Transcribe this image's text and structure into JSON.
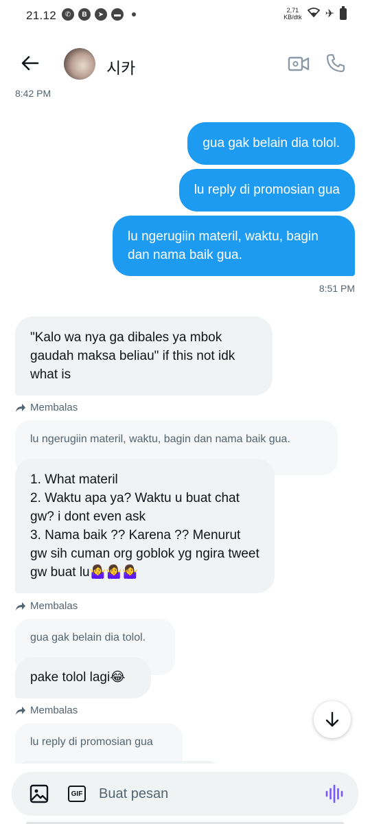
{
  "status_bar": {
    "time": "21.12",
    "speed_value": "2,71",
    "speed_unit": "KB/dtk"
  },
  "header": {
    "contact_name": "시카"
  },
  "messages": {
    "ts_top": "8:42 PM",
    "out_1": "gua gak belain dia tolol.",
    "out_2": "lu reply di promosian gua",
    "out_3": "lu ngerugiin materil, waktu, bagin dan nama baik gua.",
    "ts_out": "8:51 PM",
    "in_1": "\"Kalo wa nya ga dibales ya mbok gaudah maksa beliau\" if this not idk what is",
    "reply_label_1": "Membalas",
    "quoted_1": "lu ngerugiin materil, waktu, bagin dan nama baik gua.",
    "in_2_line1": "1. What materil",
    "in_2_line2": "2. Waktu apa ya? Waktu u buat chat gw? i dont even ask",
    "in_2_line3": "3. Nama baik ?? Karena ?? Menurut gw sih cuman org goblok yg ngira tweet gw buat lu🤷‍♀️🤷‍♀️🤷‍♀️",
    "reply_label_2": "Membalas",
    "quoted_2": "gua gak belain dia tolol.",
    "in_3": "pake tolol lagi😂",
    "reply_label_3": "Membalas",
    "quoted_3": "lu reply di promosian gua"
  },
  "composer": {
    "placeholder": "Buat pesan",
    "gif_label": "GIF"
  },
  "colors": {
    "accent": "#1d9bf0",
    "incoming_bg": "#eff3f4",
    "voice": "#7856ff"
  },
  "icons": [
    "arrow-left-icon",
    "video-icon",
    "phone-icon",
    "reply-arrow-icon",
    "arrow-down-icon",
    "image-icon",
    "gif-icon",
    "voice-wave-icon"
  ]
}
